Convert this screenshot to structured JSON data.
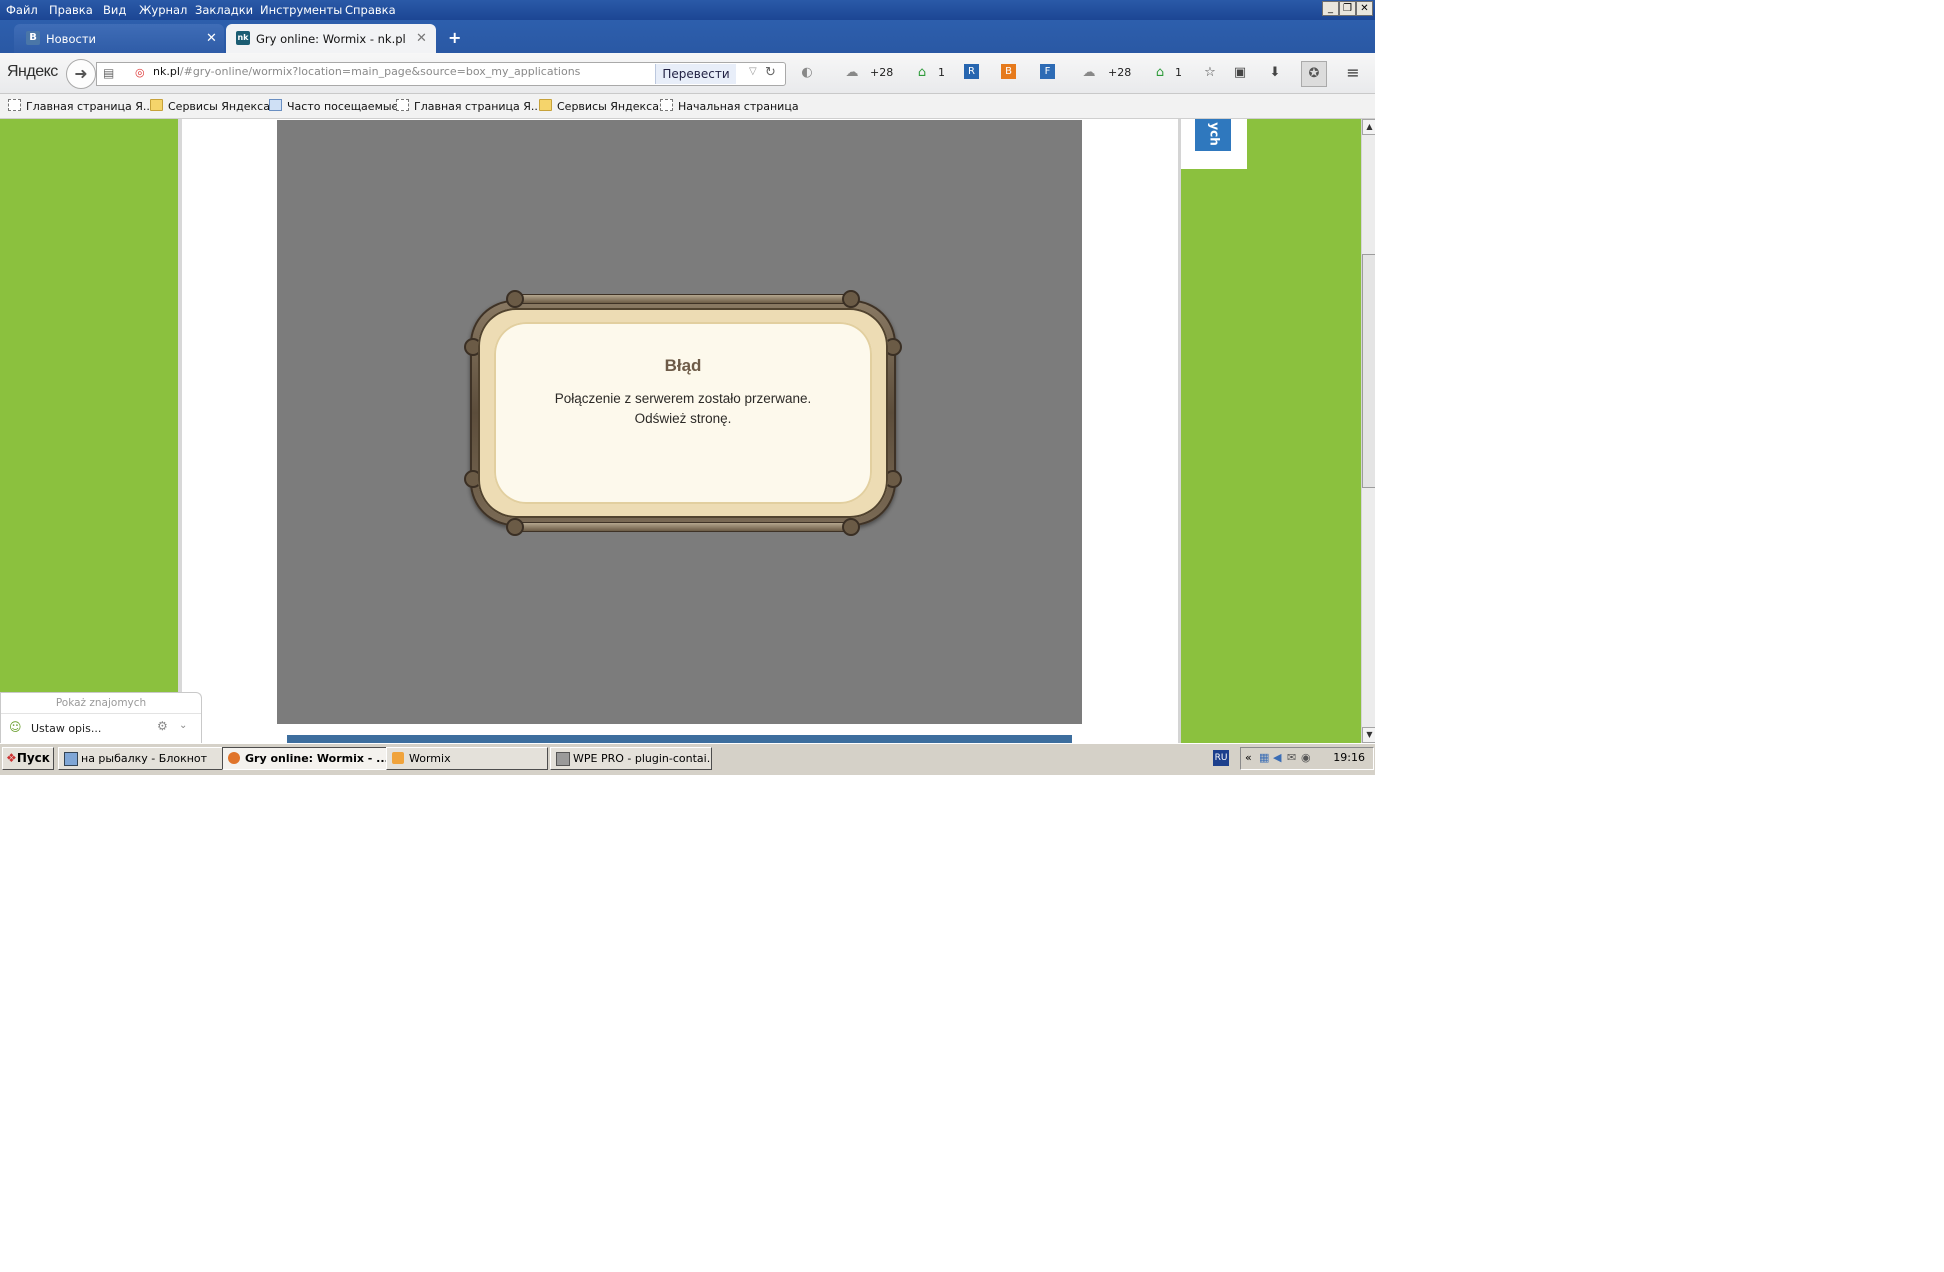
{
  "menu": [
    "Файл",
    "Правка",
    "Вид",
    "Журнал",
    "Закладки",
    "Инструменты",
    "Справка"
  ],
  "window_controls": [
    "_",
    "❐",
    "✕"
  ],
  "tabs": [
    {
      "label": "Новости",
      "favicon": "B",
      "active": false
    },
    {
      "label": "Gry online: Wormix - nk.pl",
      "favicon": "nk",
      "active": true
    }
  ],
  "new_tab_label": "+",
  "toolbar": {
    "brand": "Яндекс",
    "url_host": "nk.pl",
    "url_path": "/#gry-online/wormix?location=main_page&source=box_my_applications",
    "translate_label": "Перевести",
    "weather_1": "+28",
    "mail_count_1": "1",
    "weather_2": "+28",
    "mail_count_2": "1"
  },
  "bookmarks": [
    {
      "label": "Главная страница Я...",
      "icon": "page"
    },
    {
      "label": "Сервисы Яндекса",
      "icon": "folder"
    },
    {
      "label": "Часто посещаемые",
      "icon": "special"
    },
    {
      "label": "Главная страница Я...",
      "icon": "page"
    },
    {
      "label": "Сервисы Яндекса",
      "icon": "folder"
    },
    {
      "label": "Начальная страница",
      "icon": "page"
    }
  ],
  "side_tab": "ych",
  "dialog": {
    "title": "Błąd",
    "line1": "Połączenie z serwerem zostało przerwane.",
    "line2": "Odśwież stronę."
  },
  "chat": {
    "title": "Pokaż znajomych",
    "status": "Ustaw opis..."
  },
  "taskbar": {
    "start": "Пуск",
    "tasks": [
      {
        "label": "на рыбалку - Блокнот",
        "active": false
      },
      {
        "label": "Gry online: Wormix - ...",
        "active": true
      },
      {
        "label": "Wormix",
        "active": false
      },
      {
        "label": "WPE PRO - plugin-contai...",
        "active": false
      }
    ],
    "lang": "RU",
    "clock": "19:16"
  },
  "colors": {
    "page_green": "#8bc13e",
    "game_gray": "#7c7c7c",
    "title_bar_blue": "#1c4694"
  }
}
